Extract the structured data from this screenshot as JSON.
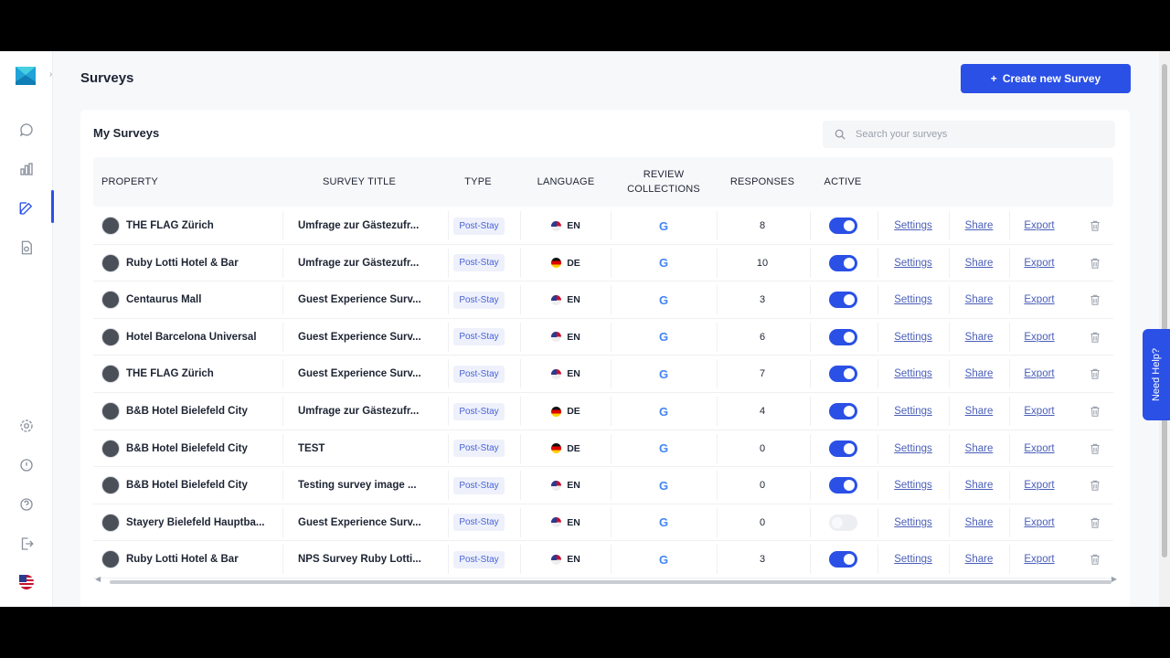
{
  "header": {
    "title": "Surveys",
    "create_button": "Create new Survey",
    "create_icon": "plus-icon"
  },
  "card": {
    "title": "My Surveys",
    "search_placeholder": "Search your surveys"
  },
  "table": {
    "columns": [
      "PROPERTY",
      "SURVEY TITLE",
      "TYPE",
      "LANGUAGE",
      "REVIEW COLLECTIONS",
      "RESPONSES",
      "ACTIVE"
    ],
    "actions": {
      "settings": "Settings",
      "share": "Share",
      "export": "Export"
    },
    "rows": [
      {
        "property": "THE FLAG Zürich",
        "title": "Umfrage zur Gästezufr...",
        "type": "Post-Stay",
        "lang": "EN",
        "flag": "us",
        "responses": "8",
        "active": true
      },
      {
        "property": "Ruby Lotti Hotel & Bar",
        "title": "Umfrage zur Gästezufr...",
        "type": "Post-Stay",
        "lang": "DE",
        "flag": "de",
        "responses": "10",
        "active": true
      },
      {
        "property": "Centaurus Mall",
        "title": "Guest Experience Surv...",
        "type": "Post-Stay",
        "lang": "EN",
        "flag": "us",
        "responses": "3",
        "active": true
      },
      {
        "property": "Hotel Barcelona Universal",
        "title": "Guest Experience Surv...",
        "type": "Post-Stay",
        "lang": "EN",
        "flag": "us",
        "responses": "6",
        "active": true
      },
      {
        "property": "THE FLAG Zürich",
        "title": "Guest Experience Surv...",
        "type": "Post-Stay",
        "lang": "EN",
        "flag": "us",
        "responses": "7",
        "active": true
      },
      {
        "property": "B&B Hotel Bielefeld City",
        "title": "Umfrage zur Gästezufr...",
        "type": "Post-Stay",
        "lang": "DE",
        "flag": "de",
        "responses": "4",
        "active": true
      },
      {
        "property": "B&B Hotel Bielefeld City",
        "title": "TEST",
        "type": "Post-Stay",
        "lang": "DE",
        "flag": "de",
        "responses": "0",
        "active": true
      },
      {
        "property": "B&B Hotel Bielefeld City",
        "title": "Testing survey image ...",
        "type": "Post-Stay",
        "lang": "EN",
        "flag": "us",
        "responses": "0",
        "active": true
      },
      {
        "property": "Stayery Bielefeld Hauptba...",
        "title": "Guest Experience Surv...",
        "type": "Post-Stay",
        "lang": "EN",
        "flag": "us",
        "responses": "0",
        "active": false
      },
      {
        "property": "Ruby Lotti Hotel & Bar",
        "title": "NPS Survey Ruby Lotti...",
        "type": "Post-Stay",
        "lang": "EN",
        "flag": "us",
        "responses": "3",
        "active": true
      }
    ]
  },
  "need_help": "Need Help?",
  "colors": {
    "accent": "#2a50e6",
    "badge_text": "#4862d8",
    "link": "#4a5eb8"
  }
}
